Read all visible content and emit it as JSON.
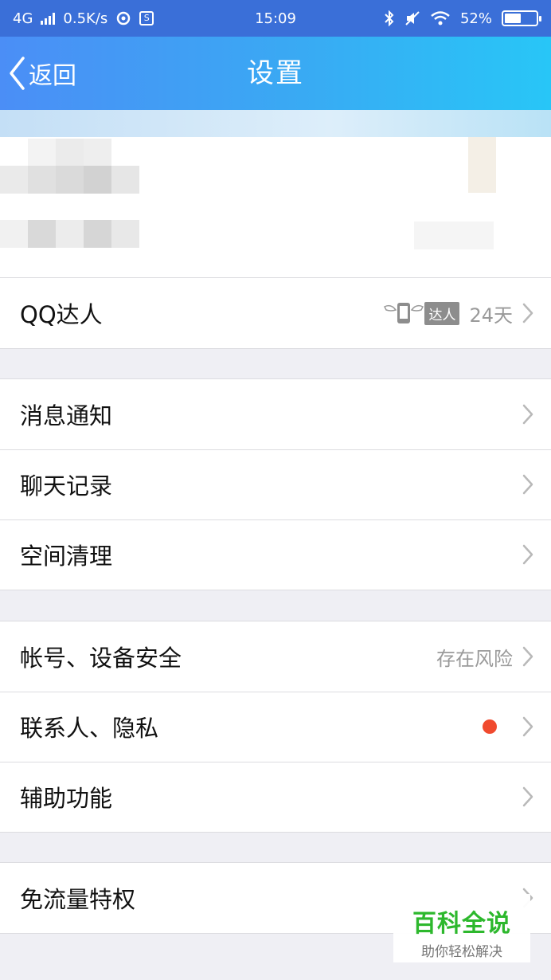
{
  "status_bar": {
    "network": "4G",
    "speed": "0.5K/s",
    "box_glyph": "S",
    "time": "15:09",
    "battery": "52%",
    "battery_level": 0.52
  },
  "nav": {
    "back_label": "返回",
    "title": "设置"
  },
  "groups": [
    {
      "rows": [
        {
          "label": "QQ达人",
          "badge": "达人",
          "value": "24天"
        }
      ]
    },
    {
      "rows": [
        {
          "label": "消息通知"
        },
        {
          "label": "聊天记录"
        },
        {
          "label": "空间清理"
        }
      ]
    },
    {
      "rows": [
        {
          "label": "帐号、设备安全",
          "value": "存在风险"
        },
        {
          "label": "联系人、隐私"
        },
        {
          "label": "辅助功能"
        }
      ]
    },
    {
      "rows": [
        {
          "label": "免流量特权"
        }
      ]
    }
  ],
  "watermark": {
    "main": "百科全说",
    "sub": "助你轻松解决"
  },
  "colors": {
    "status_bar": "#3a6fd8",
    "nav_gradient_start": "#4b8ef6",
    "nav_gradient_end": "#28c6f7",
    "notification_dot": "#f04a2e",
    "watermark_green": "#2db82d"
  }
}
